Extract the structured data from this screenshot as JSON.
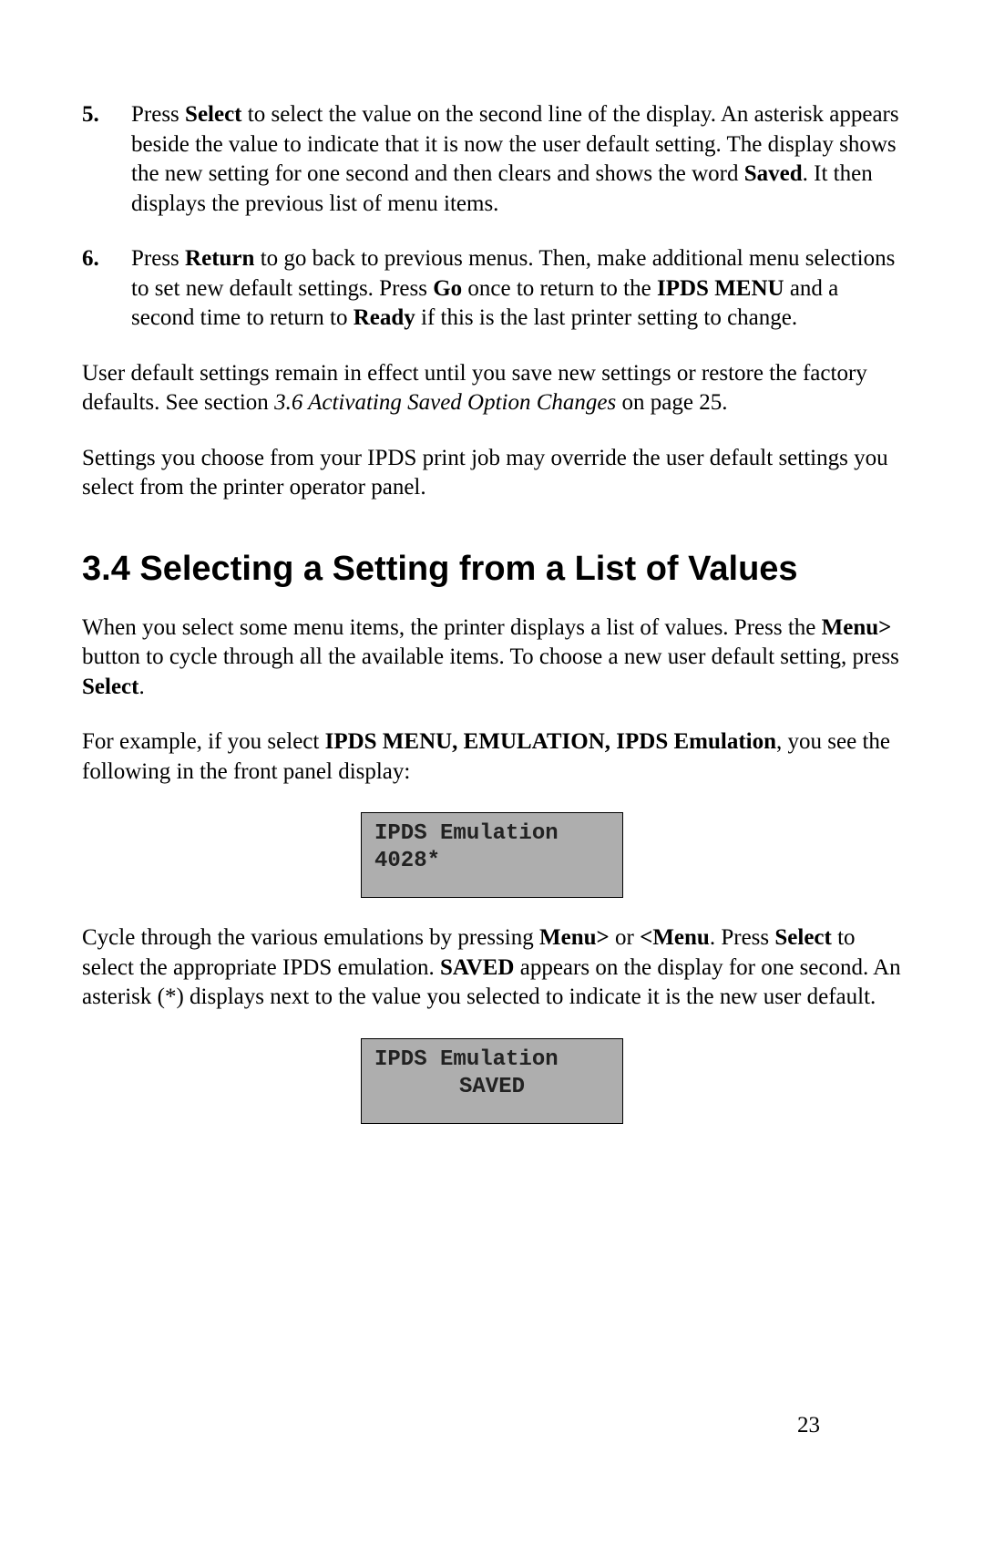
{
  "list": {
    "item5": {
      "num": "5.",
      "t1": "Press ",
      "b1": "Select",
      "t2": " to select the value on the second line of the display. An asterisk appears beside the value to indicate that it is now the user default setting. The display shows the new setting for one second and then clears and shows the word ",
      "b2": "Saved",
      "t3": ". It then displays the previous list of menu items."
    },
    "item6": {
      "num": "6.",
      "t1": "Press ",
      "b1": "Return",
      "t2": " to go back to previous menus. Then, make additional menu selections to set new default settings. Press ",
      "b2": "Go",
      "t3": " once to return to the ",
      "b3": "IPDS MENU",
      "t4": " and a second time to return to ",
      "b4": "Ready",
      "t5": " if this is the last printer setting to change."
    }
  },
  "p1": {
    "t1": "User default settings remain in effect until you save new settings or restore the factory defaults. See section ",
    "i1": "3.6 Activating Saved Option Changes",
    "t2": " on page 25."
  },
  "p2": "Settings you choose from your IPDS print job may override the user default settings you select from the printer operator panel.",
  "heading": "3.4 Selecting a Setting from a List of Values",
  "p3": {
    "t1": "When you select some menu items, the printer displays a list of values. Press the ",
    "b1": "Menu>",
    "t2": " button to cycle through all the available items. To choose a new user default setting, press ",
    "b2": "Select",
    "t3": "."
  },
  "p4": {
    "t1": "For example, if you select ",
    "b1": "IPDS MENU, EMULATION, IPDS Emulation",
    "t2": ", you see the following in the front panel display:"
  },
  "lcd1": {
    "line1": "IPDS Emulation",
    "line2": "4028*"
  },
  "p5": {
    "t1": "Cycle through the various emulations by pressing ",
    "b1": "Menu>",
    "t2": " or ",
    "b2": "<Menu",
    "t3": ". Press ",
    "b3": "Select",
    "t4": " to select the appropriate IPDS emulation. ",
    "b4": "SAVED",
    "t5": " appears on the display for one second. An asterisk (*) displays next to the value you selected to indicate it is the new user default."
  },
  "lcd2": {
    "line1": "IPDS Emulation",
    "line2": "SAVED"
  },
  "page_number": "23"
}
